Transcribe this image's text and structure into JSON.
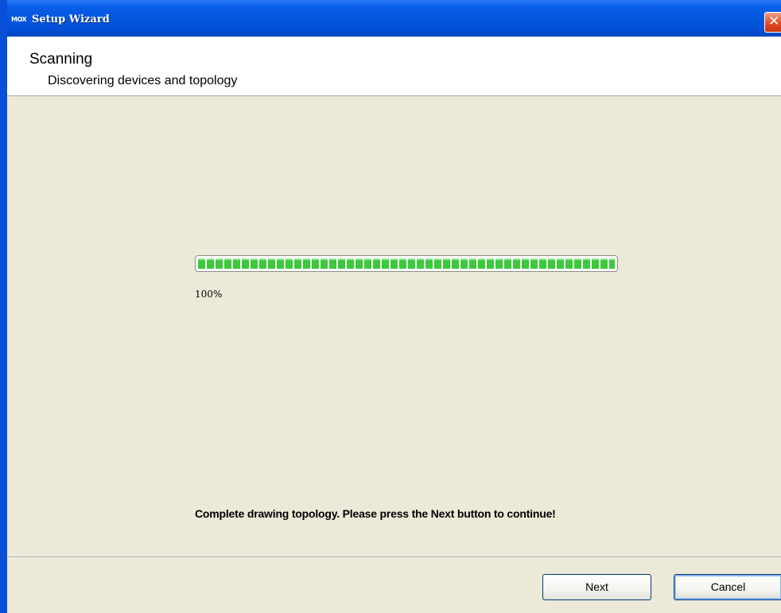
{
  "window": {
    "title": "Setup Wizard",
    "icon": "moxa-app-icon",
    "icon_text": "MOX",
    "close_glyph": "✕"
  },
  "header": {
    "title": "Scanning",
    "subtitle": "Discovering devices and topology"
  },
  "progress": {
    "value_percent": 100,
    "label": "100%",
    "fill_color": "#3CC93C"
  },
  "status": {
    "message": "Complete drawing topology. Please press the Next button to continue!"
  },
  "buttons": {
    "next_label": "Next",
    "cancel_label": "Cancel"
  },
  "colors": {
    "titlebar": "#0356DD",
    "dialog_background": "#ECE9D8",
    "close_button": "#DF4A26"
  }
}
